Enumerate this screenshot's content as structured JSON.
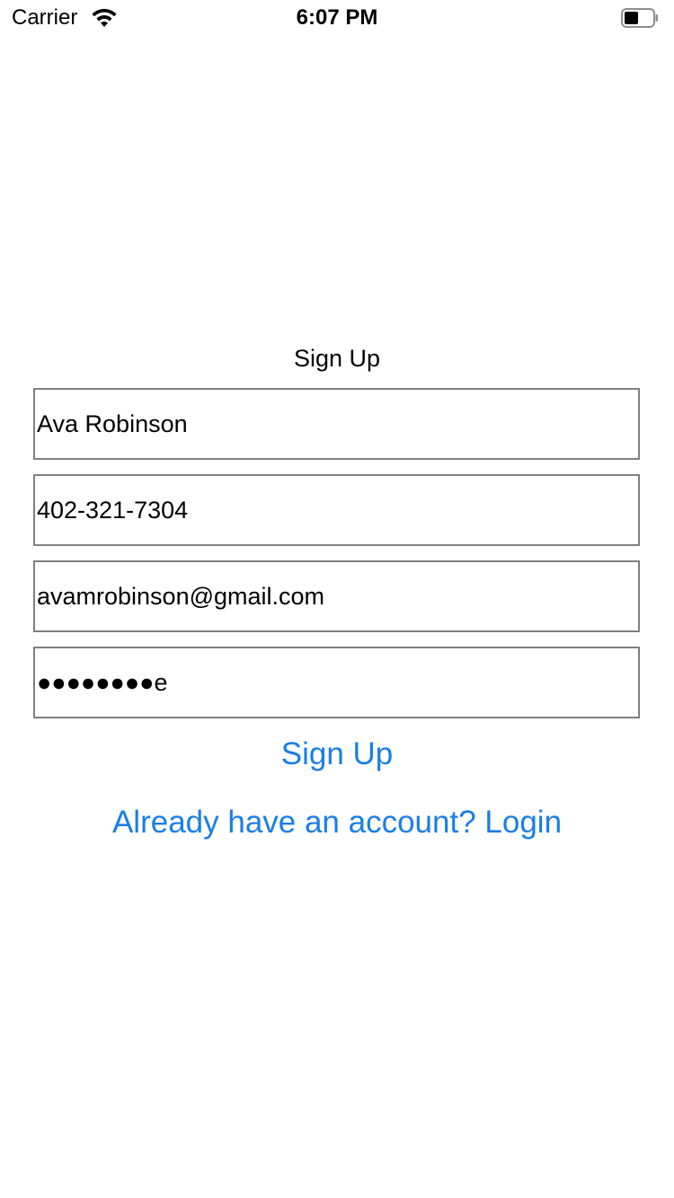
{
  "status_bar": {
    "carrier": "Carrier",
    "time": "6:07 PM"
  },
  "form": {
    "title": "Sign Up",
    "name_value": "Ava Robinson",
    "phone_value": "402-321-7304",
    "email_value": "avamrobinson@gmail.com",
    "password_value": "●●●●●●●●e"
  },
  "actions": {
    "signup_label": "Sign Up",
    "login_link_label": "Already have an account? Login"
  },
  "colors": {
    "link": "#1a7ee8",
    "field_border": "#7f7f7f"
  },
  "icons": [
    "wifi-icon",
    "battery-icon"
  ]
}
